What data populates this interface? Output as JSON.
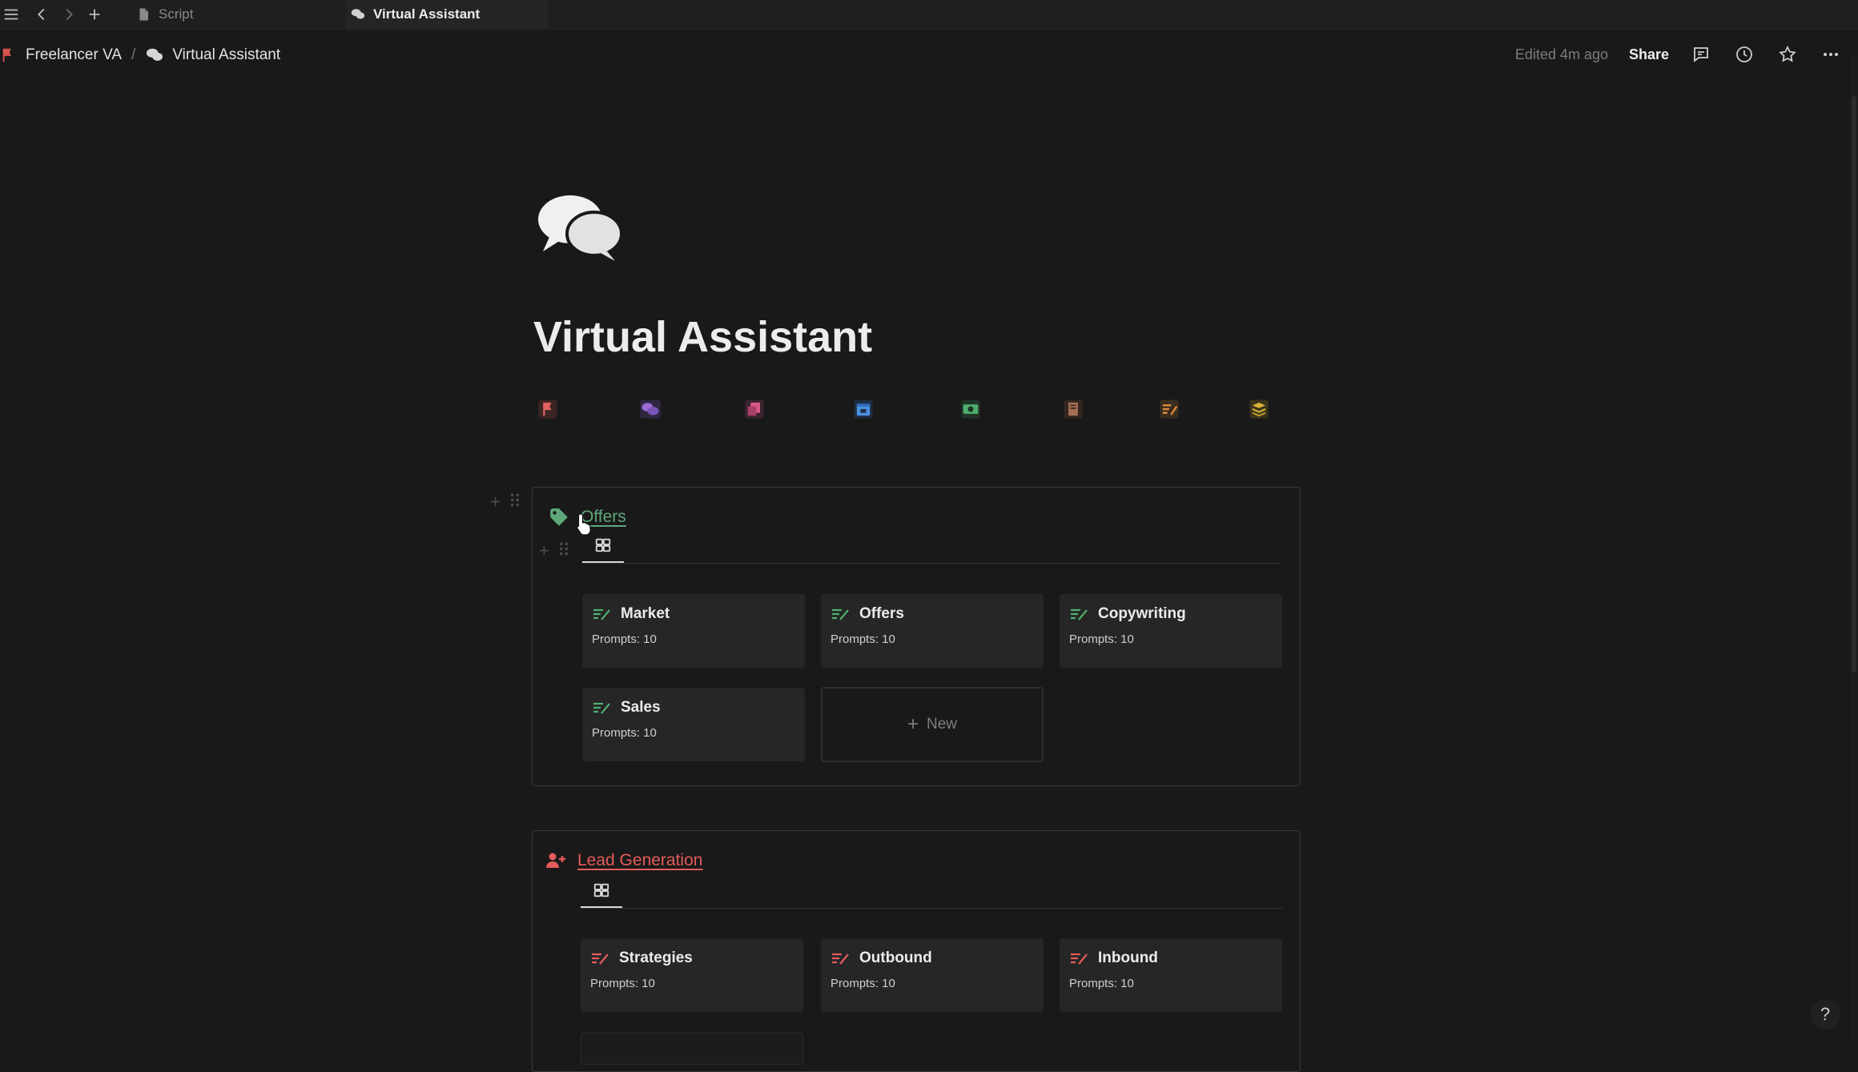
{
  "tabs": [
    {
      "label": "Script",
      "active": false
    },
    {
      "label": "Virtual Assistant",
      "active": true
    }
  ],
  "breadcrumb": {
    "workspace": "Freelancer VA",
    "separator": "/",
    "page": "Virtual Assistant"
  },
  "header": {
    "edited": "Edited 4m ago",
    "share_label": "Share"
  },
  "page": {
    "title": "Virtual Assistant",
    "icon": "speech-bubbles-icon"
  },
  "quick_links": [
    {
      "icon": "red-flag-icon",
      "color": "#e06060"
    },
    {
      "icon": "purple-bubbles-icon",
      "color": "#9b6bd6"
    },
    {
      "icon": "pink-copy-icon",
      "color": "#d9588a"
    },
    {
      "icon": "blue-calendar-icon",
      "color": "#4a8fe0"
    },
    {
      "icon": "green-money-icon",
      "color": "#4fae6f"
    },
    {
      "icon": "brown-book-icon",
      "color": "#a87155"
    },
    {
      "icon": "orange-list-icon",
      "color": "#e08b3a"
    },
    {
      "icon": "yellow-stack-icon",
      "color": "#d6b23a"
    }
  ],
  "sections": [
    {
      "title": "Offers",
      "icon": "tag-icon",
      "color": "#5fa87a",
      "cards": [
        {
          "title": "Market",
          "meta": "Prompts: 10"
        },
        {
          "title": "Offers",
          "meta": "Prompts: 10"
        },
        {
          "title": "Copywriting",
          "meta": "Prompts: 10"
        },
        {
          "title": "Sales",
          "meta": "Prompts: 10"
        }
      ],
      "new_label": "New"
    },
    {
      "title": "Lead Generation",
      "icon": "add-user-icon",
      "color": "#e55b5b",
      "cards": [
        {
          "title": "Strategies",
          "meta": "Prompts: 10"
        },
        {
          "title": "Outbound",
          "meta": "Prompts: 10"
        },
        {
          "title": "Inbound",
          "meta": "Prompts: 10"
        }
      ]
    }
  ],
  "help_label": "?"
}
